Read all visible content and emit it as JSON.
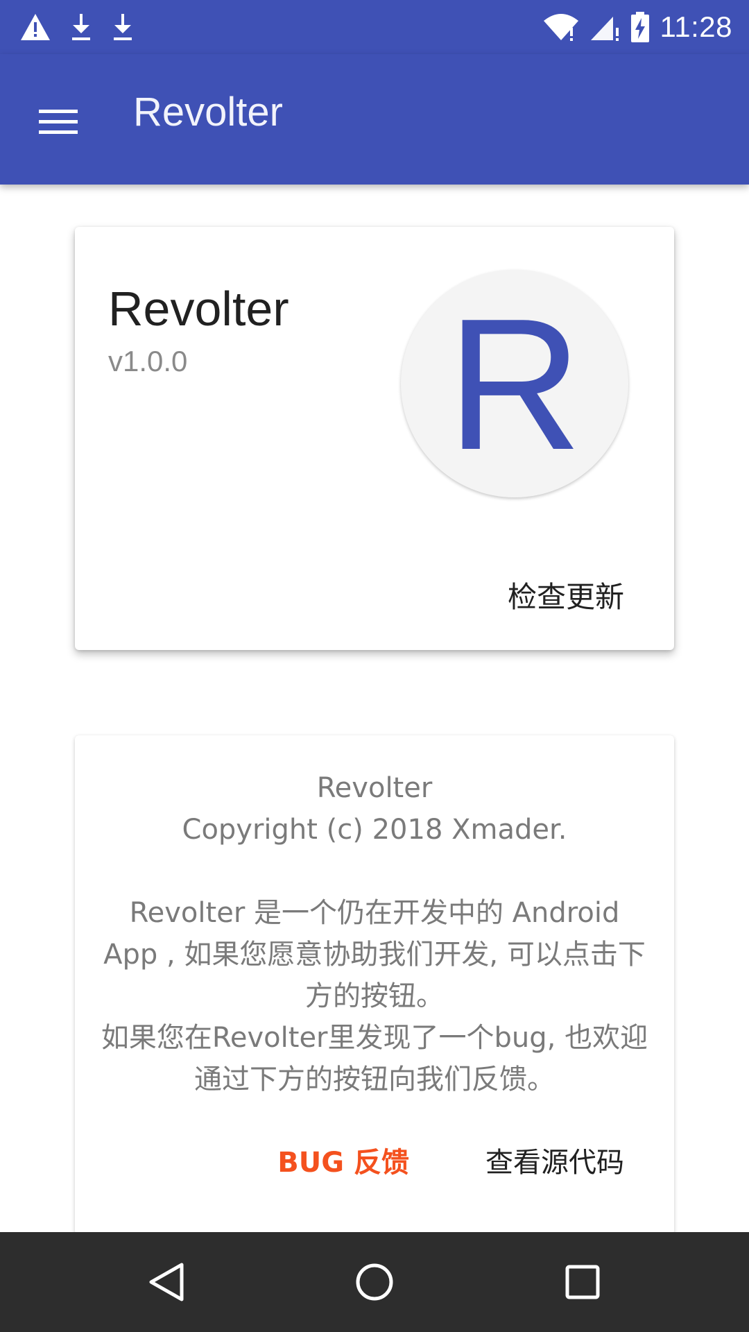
{
  "status_bar": {
    "time": "11:28",
    "icons_left": [
      "warning-icon",
      "download-icon",
      "download-icon"
    ],
    "icons_right": [
      "wifi-icon",
      "signal-icon",
      "battery-charging-icon"
    ]
  },
  "app_bar": {
    "title": "Revolter",
    "menu_icon": "menu-icon"
  },
  "about_card": {
    "app_name": "Revolter",
    "version": "v1.0.0",
    "logo_letter": "R",
    "check_update_label": "检查更新"
  },
  "info_card": {
    "line1": "Revolter",
    "line2": "Copyright (c) 2018 Xmader.",
    "paragraph1": "Revolter 是一个仍在开发中的 Android App , 如果您愿意协助我们开发, 可以点击下方的按钮。",
    "paragraph2": "如果您在Revolter里发现了一个bug, 也欢迎通过下方的按钮向我们反馈。",
    "bug_feedback_label": "BUG 反馈",
    "view_source_label": "查看源代码"
  },
  "nav_bar": {
    "icons": [
      "back-icon",
      "home-icon",
      "recents-icon"
    ]
  },
  "colors": {
    "primary": "#3f51b5",
    "accent": "#f4511e",
    "nav_background": "#2d2d2d"
  }
}
